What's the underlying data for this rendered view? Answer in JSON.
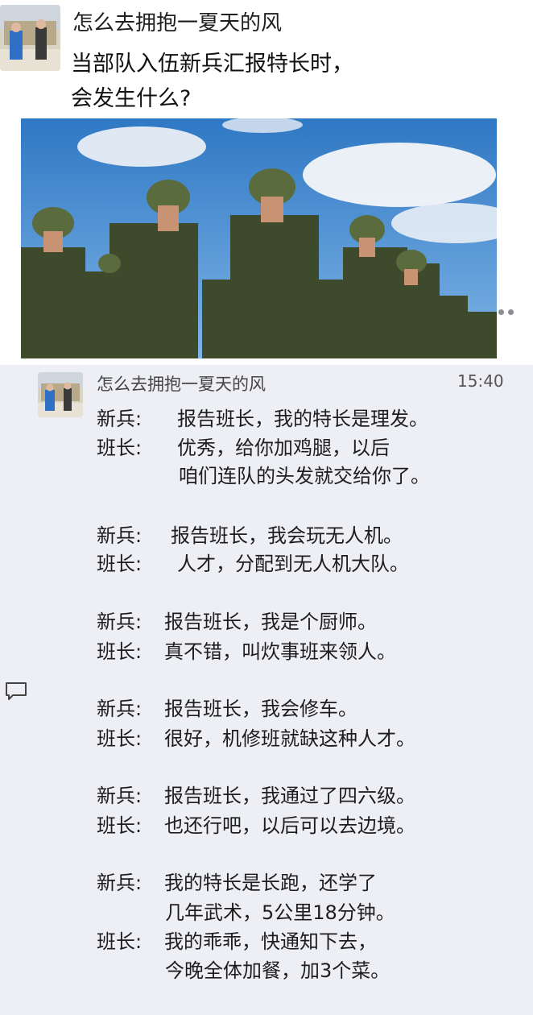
{
  "post": {
    "author": "怎么去拥抱一夏天的风",
    "lines": [
      "当部队入伍新兵汇报特长时，",
      "会发生什么?"
    ]
  },
  "reply": {
    "author": "怎么去拥抱一夏天的风",
    "time": "15:40"
  },
  "dialogue": [
    {
      "speaker": "新兵:",
      "text": "报告班长，我的特长是理发。"
    },
    {
      "speaker": "班长:",
      "text": "优秀，给你加鸡腿，以后"
    },
    {
      "speaker": "",
      "text": "咱们连队的头发就交给你了。"
    },
    {
      "speaker": "新兵:",
      "text": "报告班长，我会玩无人机。"
    },
    {
      "speaker": "班长:",
      "text": "人才，分配到无人机大队。"
    },
    {
      "speaker": "新兵:",
      "text": "报告班长，我是个厨师。"
    },
    {
      "speaker": "班长:",
      "text": "真不错，叫炊事班来领人。"
    },
    {
      "speaker": "新兵:",
      "text": "报告班长，我会修车。"
    },
    {
      "speaker": "班长:",
      "text": "很好，机修班就缺这种人才。"
    },
    {
      "speaker": "新兵:",
      "text": "报告班长，我通过了四六级。"
    },
    {
      "speaker": "班长:",
      "text": "也还行吧，以后可以去边境。"
    },
    {
      "speaker": "新兵:",
      "text": "我的特长是长跑，还学了"
    },
    {
      "speaker": "",
      "text": "几年武术，5公里18分钟。"
    },
    {
      "speaker": "班长:",
      "text": "我的乖乖，快通知下去，"
    },
    {
      "speaker": "",
      "text": "今晚全体加餐，加3个菜。"
    }
  ],
  "icons": {
    "more": "more-dots-icon",
    "comment": "comment-icon"
  },
  "colors": {
    "reply_background": "#eeeff4",
    "sky": "#3f86cc"
  }
}
